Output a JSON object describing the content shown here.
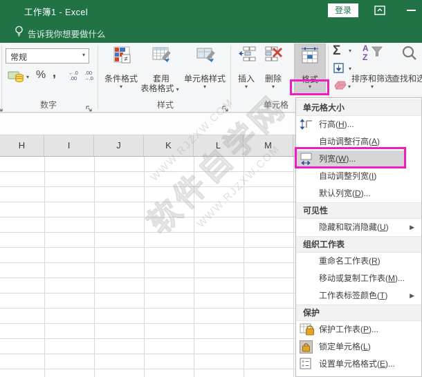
{
  "titlebar": {
    "title": "工作簿1 - Excel",
    "signin_label": "登录"
  },
  "tellme": {
    "text": "告诉我你想要做什么"
  },
  "ribbon": {
    "number": {
      "format_value": "常规",
      "percent": "%",
      "comma": ",",
      "inc_decimal": "←.0\n.00",
      "dec_decimal": ".00\n→.0",
      "group_label": "数字"
    },
    "styles": {
      "conditional_label": "条件格式",
      "not_equal_badge": "≠",
      "table_label_line1": "套用",
      "table_label_line2": "表格格式",
      "cellstyles_label": "单元格样式",
      "group_label": "样式"
    },
    "cells": {
      "insert_label": "插入",
      "delete_label": "删除",
      "format_label": "格式",
      "group_label": "单元格"
    },
    "editing": {
      "autosum": "Σ",
      "sort_letter_a": "A",
      "sort_letter_z": "Z",
      "sort_label": "排序和筛选",
      "find_label": "查找和选择"
    }
  },
  "sheet": {
    "columns": [
      "H",
      "I",
      "J",
      "K",
      "L",
      "M"
    ]
  },
  "watermark": {
    "site_name": "软件自学网",
    "site_url": "WWW.RJZXW.COM"
  },
  "menu": {
    "entries": [
      {
        "type": "header",
        "name": "cell-size",
        "label": "单元格大小"
      },
      {
        "type": "item",
        "name": "row-height",
        "icon": "row-height",
        "pre": "行高(",
        "key": "H",
        "post": ")..."
      },
      {
        "type": "item",
        "name": "autofit-row-height",
        "pre": "自动调整行高(",
        "key": "A",
        "post": ")"
      },
      {
        "type": "item",
        "name": "column-width",
        "icon": "column-width",
        "pre": "列宽(",
        "key": "W",
        "post": ")...",
        "hover": true
      },
      {
        "type": "item",
        "name": "autofit-column-width",
        "pre": "自动调整列宽(",
        "key": "I",
        "post": ")"
      },
      {
        "type": "item",
        "name": "default-width",
        "pre": "默认列宽(",
        "key": "D",
        "post": ")..."
      },
      {
        "type": "header",
        "name": "visibility",
        "label": "可见性"
      },
      {
        "type": "item",
        "name": "hide-unhide",
        "pre": "隐藏和取消隐藏(",
        "key": "U",
        "post": ")",
        "submenu": true
      },
      {
        "type": "header",
        "name": "organize-sheets",
        "label": "组织工作表"
      },
      {
        "type": "item",
        "name": "rename-sheet",
        "pre": "重命名工作表(",
        "key": "R",
        "post": ")"
      },
      {
        "type": "item",
        "name": "move-copy-sheet",
        "pre": "移动或复制工作表(",
        "key": "M",
        "post": ")..."
      },
      {
        "type": "item",
        "name": "tab-color",
        "pre": "工作表标签颜色(",
        "key": "T",
        "post": ")",
        "submenu": true
      },
      {
        "type": "header",
        "name": "protection",
        "label": "保护"
      },
      {
        "type": "item",
        "name": "protect-sheet",
        "icon": "protect-sheet",
        "pre": "保护工作表(",
        "key": "P",
        "post": ")..."
      },
      {
        "type": "item",
        "name": "lock-cell",
        "icon": "lock-cell",
        "pre": "锁定单元格(",
        "key": "L",
        "post": ")"
      },
      {
        "type": "item",
        "name": "format-cells-dialog",
        "icon": "format-cells",
        "pre": "设置单元格格式(",
        "key": "E",
        "post": ")..."
      }
    ]
  },
  "colors": {
    "brand_green": "#217346",
    "annotation_magenta": "#ef1cc0"
  }
}
